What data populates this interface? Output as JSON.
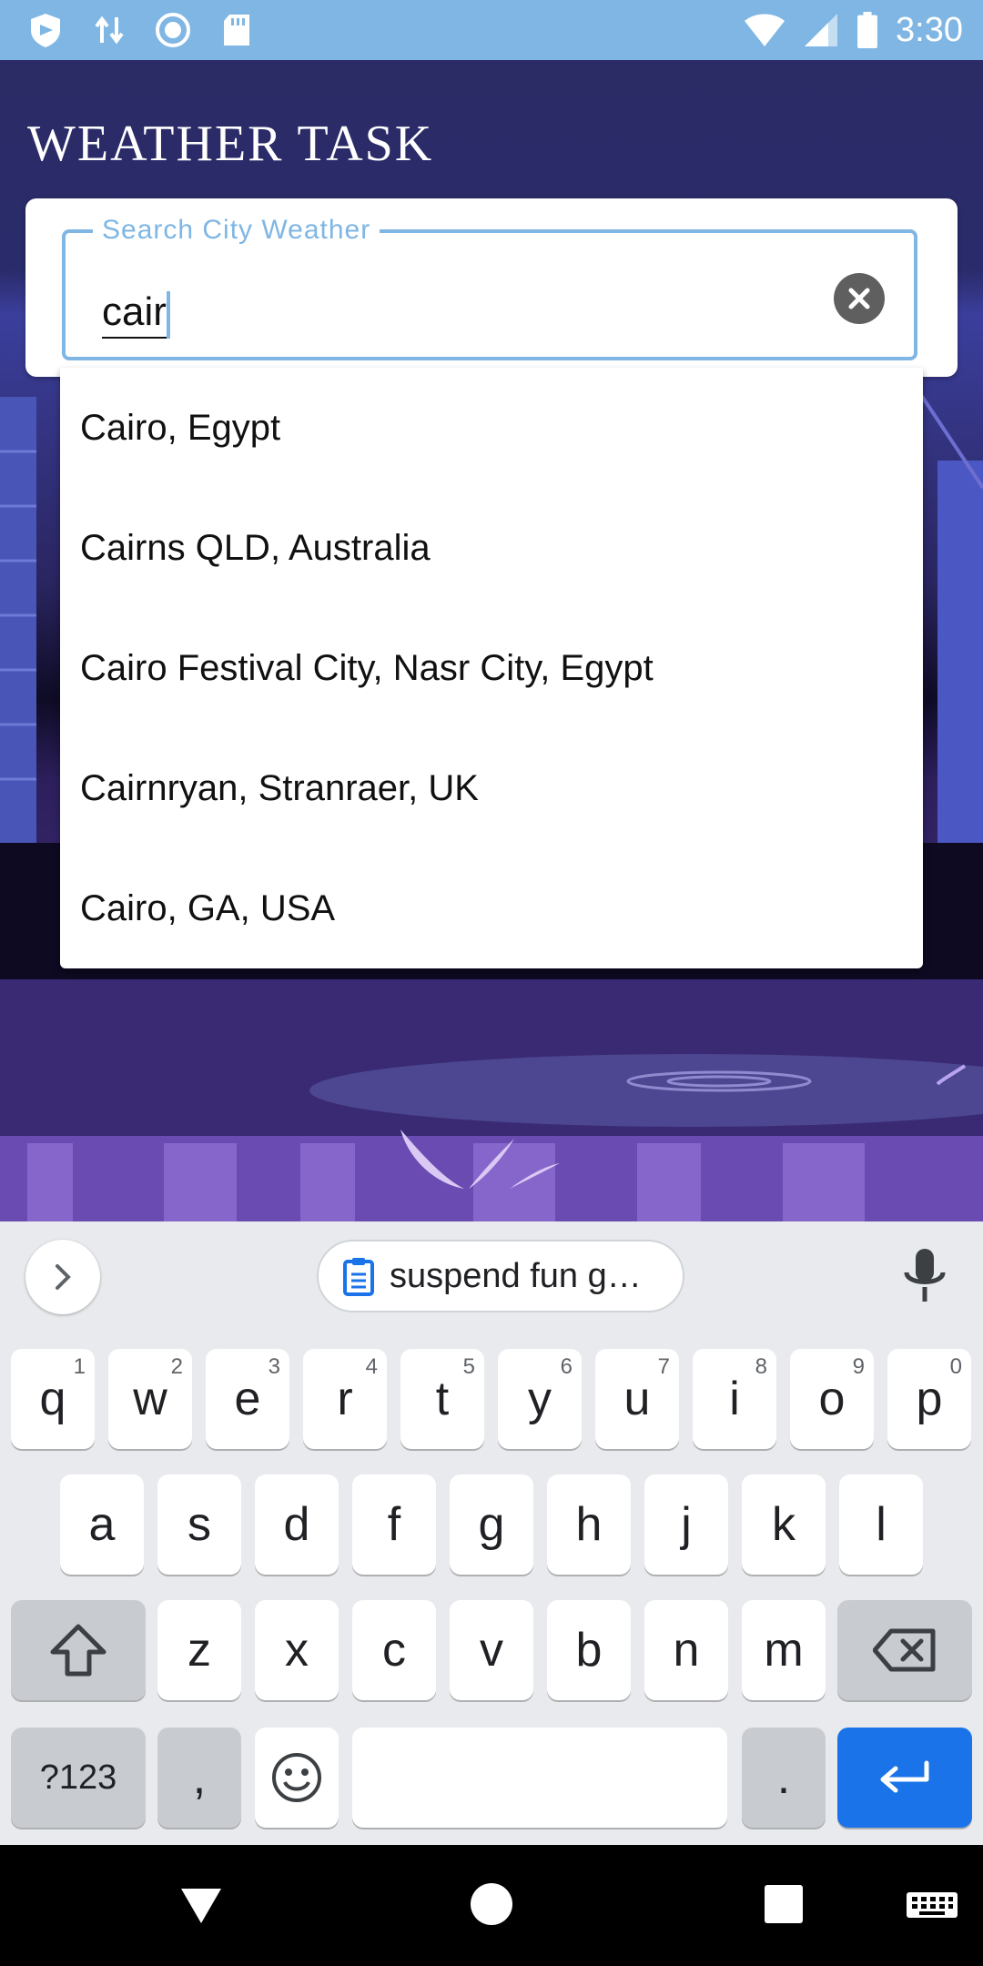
{
  "status_bar": {
    "time": "3:30",
    "left_icons": [
      "shield-icon",
      "data-transfer-icon",
      "record-icon",
      "sd-card-icon"
    ],
    "right_icons": [
      "wifi-icon",
      "signal-icon",
      "battery-icon"
    ]
  },
  "app": {
    "title": "WEATHER TASK"
  },
  "search": {
    "label": "Search City Weather",
    "value": "cair",
    "clear_icon": "clear-icon"
  },
  "suggestions": [
    "Cairo, Egypt",
    "Cairns QLD, Australia",
    "Cairo Festival City, Nasr City, Egypt",
    "Cairnryan, Stranraer, UK",
    "Cairo, GA, USA"
  ],
  "keyboard": {
    "clipboard_chip": "suspend fun g…",
    "row1": [
      {
        "key": "q",
        "hint": "1"
      },
      {
        "key": "w",
        "hint": "2"
      },
      {
        "key": "e",
        "hint": "3"
      },
      {
        "key": "r",
        "hint": "4"
      },
      {
        "key": "t",
        "hint": "5"
      },
      {
        "key": "y",
        "hint": "6"
      },
      {
        "key": "u",
        "hint": "7"
      },
      {
        "key": "i",
        "hint": "8"
      },
      {
        "key": "o",
        "hint": "9"
      },
      {
        "key": "p",
        "hint": "0"
      }
    ],
    "row2": [
      "a",
      "s",
      "d",
      "f",
      "g",
      "h",
      "j",
      "k",
      "l"
    ],
    "row3": [
      "z",
      "x",
      "c",
      "v",
      "b",
      "n",
      "m"
    ],
    "symbols_label": "?123",
    "comma_label": ",",
    "period_label": "."
  },
  "colors": {
    "status_bar": "#7fb6e3",
    "accent": "#7fb6e3",
    "enter_key": "#1a73e8"
  }
}
